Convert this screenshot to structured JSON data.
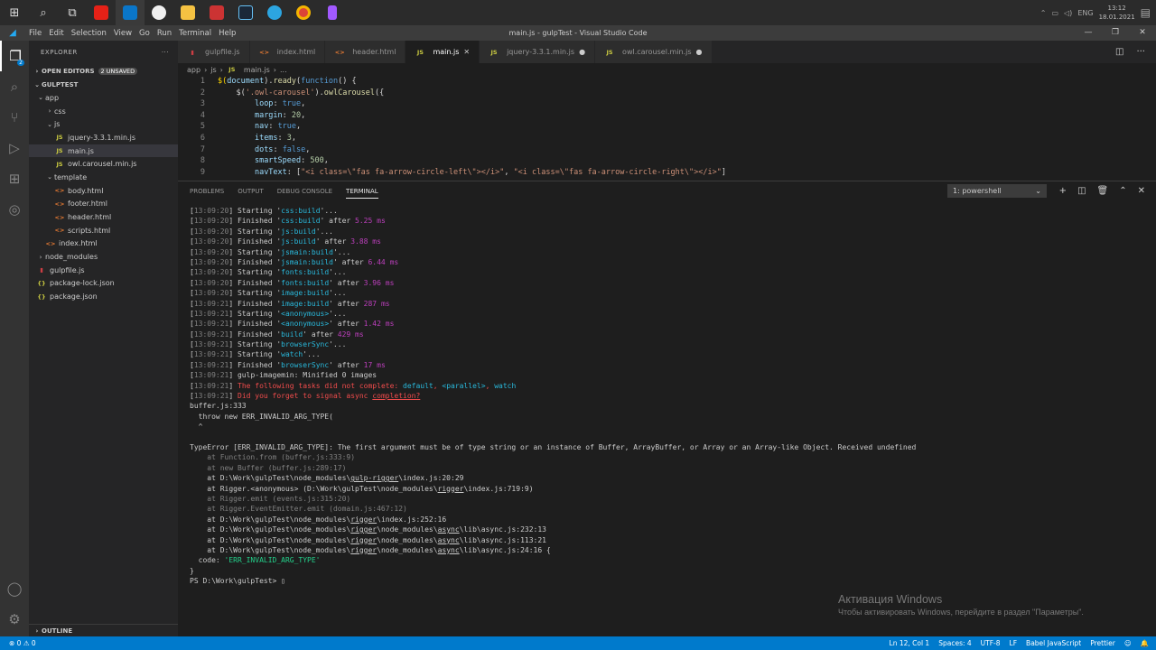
{
  "taskbar": {
    "lang": "ENG",
    "time": "13:12",
    "date": "18.01.2021"
  },
  "titlebar": {
    "menus": [
      "File",
      "Edit",
      "Selection",
      "View",
      "Go",
      "Run",
      "Terminal",
      "Help"
    ],
    "title": "main.js - gulpTest - Visual Studio Code",
    "minimize": "—",
    "restore": "❐",
    "close": "✕"
  },
  "activity": {
    "explorer_badge": "2"
  },
  "sidebar": {
    "title": "EXPLORER",
    "more": "···",
    "open_editors": "OPEN EDITORS",
    "unsaved": "2 UNSAVED",
    "root": "GULPTEST",
    "tree": [
      {
        "label": "app",
        "depth": 0,
        "chev": "⌄",
        "icon": "",
        "cls": ""
      },
      {
        "label": "css",
        "depth": 1,
        "chev": "›",
        "icon": "",
        "cls": ""
      },
      {
        "label": "js",
        "depth": 1,
        "chev": "⌄",
        "icon": "",
        "cls": ""
      },
      {
        "label": "jquery-3.3.1.min.js",
        "depth": 2,
        "chev": "",
        "icon": "JS",
        "cls": "js"
      },
      {
        "label": "main.js",
        "depth": 2,
        "chev": "",
        "icon": "JS",
        "cls": "js",
        "sel": true
      },
      {
        "label": "owl.carousel.min.js",
        "depth": 2,
        "chev": "",
        "icon": "JS",
        "cls": "js"
      },
      {
        "label": "template",
        "depth": 1,
        "chev": "⌄",
        "icon": "",
        "cls": ""
      },
      {
        "label": "body.html",
        "depth": 2,
        "chev": "",
        "icon": "<>",
        "cls": "html"
      },
      {
        "label": "footer.html",
        "depth": 2,
        "chev": "",
        "icon": "<>",
        "cls": "html"
      },
      {
        "label": "header.html",
        "depth": 2,
        "chev": "",
        "icon": "<>",
        "cls": "html"
      },
      {
        "label": "scripts.html",
        "depth": 2,
        "chev": "",
        "icon": "<>",
        "cls": "html"
      },
      {
        "label": "index.html",
        "depth": 1,
        "chev": "",
        "icon": "<>",
        "cls": "html"
      },
      {
        "label": "node_modules",
        "depth": 0,
        "chev": "›",
        "icon": "",
        "cls": ""
      },
      {
        "label": "gulpfile.js",
        "depth": 0,
        "chev": "",
        "icon": "▮",
        "cls": "gulp"
      },
      {
        "label": "package-lock.json",
        "depth": 0,
        "chev": "",
        "icon": "{}",
        "cls": "json"
      },
      {
        "label": "package.json",
        "depth": 0,
        "chev": "",
        "icon": "{}",
        "cls": "json"
      }
    ],
    "outline": "OUTLINE"
  },
  "tabs": [
    {
      "label": "gulpfile.js",
      "icon": "▮",
      "cls": "gulp",
      "mark": ""
    },
    {
      "label": "index.html",
      "icon": "<>",
      "cls": "html",
      "mark": ""
    },
    {
      "label": "header.html",
      "icon": "<>",
      "cls": "html",
      "mark": ""
    },
    {
      "label": "main.js",
      "icon": "JS",
      "cls": "js",
      "mark": "✕",
      "active": true
    },
    {
      "label": "jquery-3.3.1.min.js",
      "icon": "JS",
      "cls": "js",
      "mark": "●"
    },
    {
      "label": "owl.carousel.min.js",
      "icon": "JS",
      "cls": "js",
      "mark": "●"
    }
  ],
  "breadcrumb": [
    "app",
    "›",
    "js",
    "›",
    "JS",
    "main.js",
    "›",
    "..."
  ],
  "editor_lines": [
    [
      [
        "$(",
        "y"
      ],
      [
        "document",
        "p"
      ],
      [
        ").",
        "d"
      ],
      [
        "ready",
        "f"
      ],
      [
        "(",
        "d"
      ],
      [
        "function",
        "k"
      ],
      [
        "() {",
        "d"
      ]
    ],
    [
      [
        "    $(",
        "d"
      ],
      [
        "'.owl-carousel'",
        "s"
      ],
      [
        ").",
        "d"
      ],
      [
        "owlCarousel",
        "f"
      ],
      [
        "({",
        "d"
      ]
    ],
    [
      [
        "        ",
        "d"
      ],
      [
        "loop",
        "p"
      ],
      [
        ": ",
        "d"
      ],
      [
        "true",
        "k"
      ],
      [
        ",",
        "d"
      ]
    ],
    [
      [
        "        ",
        "d"
      ],
      [
        "margin",
        "p"
      ],
      [
        ": ",
        "d"
      ],
      [
        "20",
        "n"
      ],
      [
        ",",
        "d"
      ]
    ],
    [
      [
        "        ",
        "d"
      ],
      [
        "nav",
        "p"
      ],
      [
        ": ",
        "d"
      ],
      [
        "true",
        "k"
      ],
      [
        ",",
        "d"
      ]
    ],
    [
      [
        "        ",
        "d"
      ],
      [
        "items",
        "p"
      ],
      [
        ": ",
        "d"
      ],
      [
        "3",
        "n"
      ],
      [
        ",",
        "d"
      ]
    ],
    [
      [
        "        ",
        "d"
      ],
      [
        "dots",
        "p"
      ],
      [
        ": ",
        "d"
      ],
      [
        "false",
        "k"
      ],
      [
        ",",
        "d"
      ]
    ],
    [
      [
        "        ",
        "d"
      ],
      [
        "smartSpeed",
        "p"
      ],
      [
        ": ",
        "d"
      ],
      [
        "500",
        "n"
      ],
      [
        ",",
        "d"
      ]
    ],
    [
      [
        "        ",
        "d"
      ],
      [
        "navText",
        "p"
      ],
      [
        ": [",
        "d"
      ],
      [
        "\"<i class=\\\"fas fa-arrow-circle-left\\\"></i>\"",
        "s"
      ],
      [
        ", ",
        "d"
      ],
      [
        "\"<i class=\\\"fas fa-arrow-circle-right\\\"></i>\"",
        "s"
      ],
      [
        "]",
        "d"
      ]
    ]
  ],
  "panel": {
    "tabs": [
      "PROBLEMS",
      "OUTPUT",
      "DEBUG CONSOLE",
      "TERMINAL"
    ],
    "shell": "1: powershell",
    "tools": [
      "+",
      "◫",
      "🗑",
      "⌃",
      "✕"
    ]
  },
  "terminal": [
    [
      [
        "[",
        "tw"
      ],
      [
        "13:09:20",
        "ts"
      ],
      [
        "] Starting '",
        "tw"
      ],
      [
        "css:build",
        "tt"
      ],
      [
        "'...",
        "tw"
      ]
    ],
    [
      [
        "[",
        "tw"
      ],
      [
        "13:09:20",
        "ts"
      ],
      [
        "] Finished '",
        "tw"
      ],
      [
        "css:build",
        "tt"
      ],
      [
        "' after ",
        "tw"
      ],
      [
        "5.25 ms",
        "tm"
      ]
    ],
    [
      [
        "[",
        "tw"
      ],
      [
        "13:09:20",
        "ts"
      ],
      [
        "] Starting '",
        "tw"
      ],
      [
        "js:build",
        "tt"
      ],
      [
        "'...",
        "tw"
      ]
    ],
    [
      [
        "[",
        "tw"
      ],
      [
        "13:09:20",
        "ts"
      ],
      [
        "] Finished '",
        "tw"
      ],
      [
        "js:build",
        "tt"
      ],
      [
        "' after ",
        "tw"
      ],
      [
        "3.88 ms",
        "tm"
      ]
    ],
    [
      [
        "[",
        "tw"
      ],
      [
        "13:09:20",
        "ts"
      ],
      [
        "] Starting '",
        "tw"
      ],
      [
        "jsmain:build",
        "tt"
      ],
      [
        "'...",
        "tw"
      ]
    ],
    [
      [
        "[",
        "tw"
      ],
      [
        "13:09:20",
        "ts"
      ],
      [
        "] Finished '",
        "tw"
      ],
      [
        "jsmain:build",
        "tt"
      ],
      [
        "' after ",
        "tw"
      ],
      [
        "6.44 ms",
        "tm"
      ]
    ],
    [
      [
        "[",
        "tw"
      ],
      [
        "13:09:20",
        "ts"
      ],
      [
        "] Starting '",
        "tw"
      ],
      [
        "fonts:build",
        "tt"
      ],
      [
        "'...",
        "tw"
      ]
    ],
    [
      [
        "[",
        "tw"
      ],
      [
        "13:09:20",
        "ts"
      ],
      [
        "] Finished '",
        "tw"
      ],
      [
        "fonts:build",
        "tt"
      ],
      [
        "' after ",
        "tw"
      ],
      [
        "3.96 ms",
        "tm"
      ]
    ],
    [
      [
        "[",
        "tw"
      ],
      [
        "13:09:20",
        "ts"
      ],
      [
        "] Starting '",
        "tw"
      ],
      [
        "image:build",
        "tt"
      ],
      [
        "'...",
        "tw"
      ]
    ],
    [
      [
        "[",
        "tw"
      ],
      [
        "13:09:21",
        "ts"
      ],
      [
        "] Finished '",
        "tw"
      ],
      [
        "image:build",
        "tt"
      ],
      [
        "' after ",
        "tw"
      ],
      [
        "287 ms",
        "tm"
      ]
    ],
    [
      [
        "[",
        "tw"
      ],
      [
        "13:09:21",
        "ts"
      ],
      [
        "] Starting '",
        "tw"
      ],
      [
        "<anonymous>",
        "tt"
      ],
      [
        "'...",
        "tw"
      ]
    ],
    [
      [
        "[",
        "tw"
      ],
      [
        "13:09:21",
        "ts"
      ],
      [
        "] Finished '",
        "tw"
      ],
      [
        "<anonymous>",
        "tt"
      ],
      [
        "' after ",
        "tw"
      ],
      [
        "1.42 ms",
        "tm"
      ]
    ],
    [
      [
        "[",
        "tw"
      ],
      [
        "13:09:21",
        "ts"
      ],
      [
        "] Finished '",
        "tw"
      ],
      [
        "build",
        "tt"
      ],
      [
        "' after ",
        "tw"
      ],
      [
        "429 ms",
        "tm"
      ]
    ],
    [
      [
        "[",
        "tw"
      ],
      [
        "13:09:21",
        "ts"
      ],
      [
        "] Starting '",
        "tw"
      ],
      [
        "browserSync",
        "tt"
      ],
      [
        "'...",
        "tw"
      ]
    ],
    [
      [
        "[",
        "tw"
      ],
      [
        "13:09:21",
        "ts"
      ],
      [
        "] Starting '",
        "tw"
      ],
      [
        "watch",
        "tt"
      ],
      [
        "'...",
        "tw"
      ]
    ],
    [
      [
        "[",
        "tw"
      ],
      [
        "13:09:21",
        "ts"
      ],
      [
        "] Finished '",
        "tw"
      ],
      [
        "browserSync",
        "tt"
      ],
      [
        "' after ",
        "tw"
      ],
      [
        "17 ms",
        "tm"
      ]
    ],
    [
      [
        "[",
        "tw"
      ],
      [
        "13:09:21",
        "ts"
      ],
      [
        "] gulp-imagemin: Minified 0 images",
        "tw"
      ]
    ],
    [
      [
        "[",
        "tw"
      ],
      [
        "13:09:21",
        "ts"
      ],
      [
        "] ",
        "tw"
      ],
      [
        "The following tasks did not complete: ",
        "tr2"
      ],
      [
        "default",
        "tt"
      ],
      [
        ", ",
        "tr2"
      ],
      [
        "<parallel>",
        "tt"
      ],
      [
        ", ",
        "tr2"
      ],
      [
        "watch",
        "tt"
      ]
    ],
    [
      [
        "[",
        "tw"
      ],
      [
        "13:09:21",
        "ts"
      ],
      [
        "] ",
        "tw"
      ],
      [
        "Did you forget to signal async ",
        "tr2"
      ],
      [
        "completion?",
        "tr2 ul"
      ]
    ],
    [
      [
        "buffer.js:333",
        "tw"
      ]
    ],
    [
      [
        "  throw new ERR_INVALID_ARG_TYPE(",
        "tw"
      ]
    ],
    [
      [
        "  ^",
        "tw"
      ]
    ],
    [
      [
        "",
        "tw"
      ]
    ],
    [
      [
        "TypeError [ERR_INVALID_ARG_TYPE]: The first argument must be of type string or an instance of Buffer, ArrayBuffer, or Array or an Array-like Object. Received undefined",
        "tw"
      ]
    ],
    [
      [
        "    at Function.from (buffer.js:333:9)",
        "tg"
      ]
    ],
    [
      [
        "    at new Buffer (buffer.js:289:17)",
        "tg"
      ]
    ],
    [
      [
        "    at D:\\Work\\gulpTest\\node_modules\\",
        "tw"
      ],
      [
        "gulp-rigger",
        "tw ul"
      ],
      [
        "\\index.js:20:29",
        "tw"
      ]
    ],
    [
      [
        "    at Rigger.<anonymous> (D:\\Work\\gulpTest\\node_modules\\",
        "tw"
      ],
      [
        "rigger",
        "tw ul"
      ],
      [
        "\\index.js:719:9)",
        "tw"
      ]
    ],
    [
      [
        "    at Rigger.emit (events.js:315:20)",
        "tg"
      ]
    ],
    [
      [
        "    at Rigger.EventEmitter.emit (domain.js:467:12)",
        "tg"
      ]
    ],
    [
      [
        "    at D:\\Work\\gulpTest\\node_modules\\",
        "tw"
      ],
      [
        "rigger",
        "tw ul"
      ],
      [
        "\\index.js:252:16",
        "tw"
      ]
    ],
    [
      [
        "    at D:\\Work\\gulpTest\\node_modules\\",
        "tw"
      ],
      [
        "rigger",
        "tw ul"
      ],
      [
        "\\node_modules\\",
        "tw"
      ],
      [
        "async",
        "tw ul"
      ],
      [
        "\\lib\\async.js:232:13",
        "tw"
      ]
    ],
    [
      [
        "    at D:\\Work\\gulpTest\\node_modules\\",
        "tw"
      ],
      [
        "rigger",
        "tw ul"
      ],
      [
        "\\node_modules\\",
        "tw"
      ],
      [
        "async",
        "tw ul"
      ],
      [
        "\\lib\\async.js:113:21",
        "tw"
      ]
    ],
    [
      [
        "    at D:\\Work\\gulpTest\\node_modules\\",
        "tw"
      ],
      [
        "rigger",
        "tw ul"
      ],
      [
        "\\node_modules\\",
        "tw"
      ],
      [
        "async",
        "tw ul"
      ],
      [
        "\\lib\\async.js:24:16 {",
        "tw"
      ]
    ],
    [
      [
        "  code: ",
        "tw"
      ],
      [
        "'ERR_INVALID_ARG_TYPE'",
        "tgr"
      ]
    ],
    [
      [
        "}",
        "tw"
      ]
    ],
    [
      [
        "PS D:\\Work\\gulpTest> ",
        "tw"
      ],
      [
        "▯",
        "tw"
      ]
    ]
  ],
  "activation": {
    "title": "Активация Windows",
    "subtitle": "Чтобы активировать Windows, перейдите в раздел \"Параметры\"."
  },
  "statusbar": {
    "errors": "⊗ 0 ⚠ 0",
    "right": [
      "Ln 12, Col 1",
      "Spaces: 4",
      "UTF-8",
      "LF",
      "Babel JavaScript",
      "Prettier",
      "☺",
      "🔔"
    ]
  }
}
